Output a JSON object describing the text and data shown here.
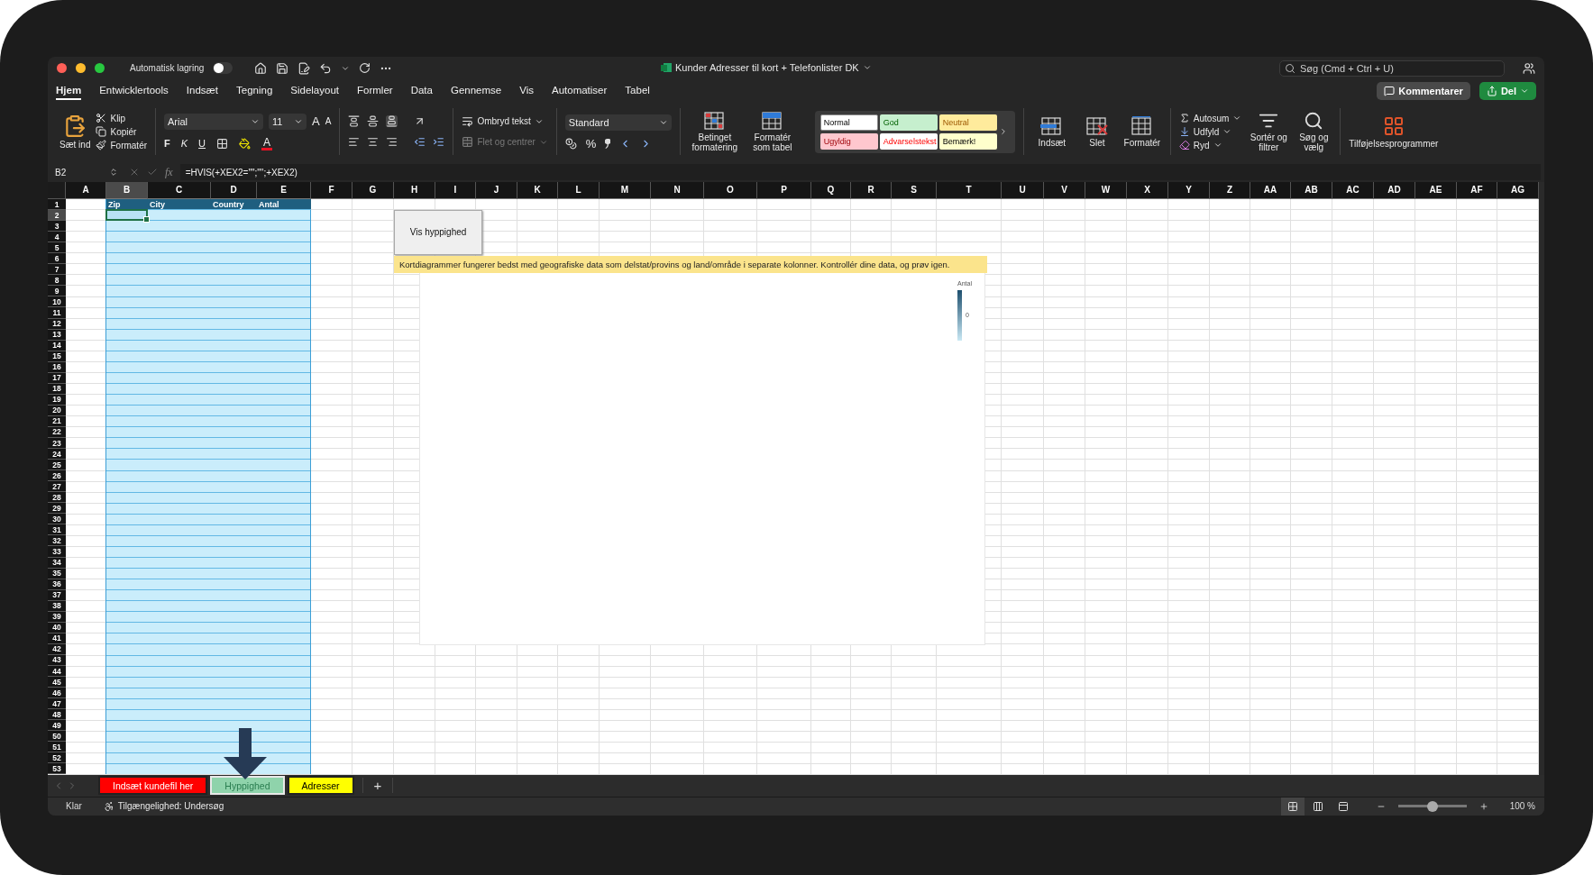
{
  "window": {
    "title": "Kunder Adresser til kort + Telefonlister DK",
    "autosave_label": "Automatisk lagring",
    "autosave_on": false
  },
  "search": {
    "placeholder": "Søg (Cmd + Ctrl + U)"
  },
  "ribbon_tabs": [
    {
      "label": "Hjem",
      "selected": true
    },
    {
      "label": "Entwicklertools",
      "selected": false
    },
    {
      "label": "Indsæt",
      "selected": false
    },
    {
      "label": "Tegning",
      "selected": false
    },
    {
      "label": "Sidelayout",
      "selected": false
    },
    {
      "label": "Formler",
      "selected": false
    },
    {
      "label": "Data",
      "selected": false
    },
    {
      "label": "Gennemse",
      "selected": false
    },
    {
      "label": "Vis",
      "selected": false
    },
    {
      "label": "Automatiser",
      "selected": false
    },
    {
      "label": "Tabel",
      "selected": false
    }
  ],
  "comments_button": "Kommentarer",
  "share_button": "Del",
  "clipboard": {
    "paste": "Sæt ind",
    "cut": "Klip",
    "copy": "Kopiér",
    "format_painter": "Formatér"
  },
  "font": {
    "name": "Arial",
    "size": "11",
    "grow": "A",
    "shrink": "A",
    "bold": "F",
    "italic": "K",
    "underline": "U",
    "font_color": "A"
  },
  "alignment": {
    "wrap_text": "Ombryd tekst",
    "merge_center": "Flet og centrer",
    "merge_disabled": true
  },
  "number": {
    "format": "Standard",
    "percent": "%"
  },
  "style_tools": [
    {
      "label": "Betinget formatering",
      "kind": "conditional"
    },
    {
      "label": "Formatér som tabel",
      "kind": "table"
    }
  ],
  "cell_styles": [
    {
      "label": "Normal",
      "kind": "normal",
      "selected": true
    },
    {
      "label": "God",
      "kind": "good",
      "selected": false
    },
    {
      "label": "Neutral",
      "kind": "neutral",
      "selected": false
    },
    {
      "label": "Ugyldig",
      "kind": "bad",
      "selected": false
    },
    {
      "label": "Advarselstekst",
      "kind": "warning",
      "selected": false
    },
    {
      "label": "Bemærk!",
      "kind": "note",
      "selected": false
    }
  ],
  "cells": [
    {
      "label": "Indsæt",
      "kind": "insert"
    },
    {
      "label": "Slet",
      "kind": "delete"
    },
    {
      "label": "Formatér",
      "kind": "format"
    }
  ],
  "editing": {
    "autosum": "Autosum",
    "fill": "Udfyld",
    "clear": "Ryd",
    "sort_filter": "Sortér og filtrer",
    "find_select": "Søg og vælg"
  },
  "addins": "Tilføjelsesprogrammer",
  "formula_bar": {
    "name_box": "B2",
    "fx": "fx",
    "formula": "=HVIS(+XEX2=\"\";\"\";+XEX2)"
  },
  "columns": [
    {
      "label": "A",
      "selected": false
    },
    {
      "label": "B",
      "selected": true
    },
    {
      "label": "C",
      "selected": false
    },
    {
      "label": "D",
      "selected": false
    },
    {
      "label": "E",
      "selected": false
    },
    {
      "label": "F",
      "selected": false
    },
    {
      "label": "G",
      "selected": false
    },
    {
      "label": "H",
      "selected": false
    },
    {
      "label": "I",
      "selected": false
    },
    {
      "label": "J",
      "selected": false
    },
    {
      "label": "K",
      "selected": false
    },
    {
      "label": "L",
      "selected": false
    },
    {
      "label": "M",
      "selected": false
    },
    {
      "label": "N",
      "selected": false
    },
    {
      "label": "O",
      "selected": false
    },
    {
      "label": "P",
      "selected": false
    },
    {
      "label": "Q",
      "selected": false
    },
    {
      "label": "R",
      "selected": false
    },
    {
      "label": "S",
      "selected": false
    },
    {
      "label": "T",
      "selected": false
    },
    {
      "label": "U",
      "selected": false
    },
    {
      "label": "V",
      "selected": false
    },
    {
      "label": "W",
      "selected": false
    },
    {
      "label": "X",
      "selected": false
    },
    {
      "label": "Y",
      "selected": false
    },
    {
      "label": "Z",
      "selected": false
    },
    {
      "label": "AA",
      "selected": false
    },
    {
      "label": "AB",
      "selected": false
    },
    {
      "label": "AC",
      "selected": false
    },
    {
      "label": "AD",
      "selected": false
    },
    {
      "label": "AE",
      "selected": false
    },
    {
      "label": "AF",
      "selected": false
    },
    {
      "label": "AG",
      "selected": false
    }
  ],
  "rows": [
    {
      "label": "1",
      "selected": false
    },
    {
      "label": "2",
      "selected": true
    },
    {
      "label": "3",
      "selected": false
    },
    {
      "label": "4",
      "selected": false
    },
    {
      "label": "5",
      "selected": false
    },
    {
      "label": "6",
      "selected": false
    },
    {
      "label": "7",
      "selected": false
    },
    {
      "label": "8",
      "selected": false
    },
    {
      "label": "9",
      "selected": false
    },
    {
      "label": "10",
      "selected": false
    },
    {
      "label": "11",
      "selected": false
    },
    {
      "label": "12",
      "selected": false
    },
    {
      "label": "13",
      "selected": false
    },
    {
      "label": "14",
      "selected": false
    },
    {
      "label": "15",
      "selected": false
    },
    {
      "label": "16",
      "selected": false
    },
    {
      "label": "17",
      "selected": false
    },
    {
      "label": "18",
      "selected": false
    },
    {
      "label": "19",
      "selected": false
    },
    {
      "label": "20",
      "selected": false
    },
    {
      "label": "21",
      "selected": false
    },
    {
      "label": "22",
      "selected": false
    },
    {
      "label": "23",
      "selected": false
    },
    {
      "label": "24",
      "selected": false
    },
    {
      "label": "25",
      "selected": false
    },
    {
      "label": "26",
      "selected": false
    },
    {
      "label": "27",
      "selected": false
    },
    {
      "label": "28",
      "selected": false
    },
    {
      "label": "29",
      "selected": false
    },
    {
      "label": "30",
      "selected": false
    },
    {
      "label": "31",
      "selected": false
    },
    {
      "label": "32",
      "selected": false
    },
    {
      "label": "33",
      "selected": false
    },
    {
      "label": "34",
      "selected": false
    },
    {
      "label": "35",
      "selected": false
    },
    {
      "label": "36",
      "selected": false
    },
    {
      "label": "37",
      "selected": false
    },
    {
      "label": "38",
      "selected": false
    },
    {
      "label": "39",
      "selected": false
    },
    {
      "label": "40",
      "selected": false
    },
    {
      "label": "41",
      "selected": false
    },
    {
      "label": "42",
      "selected": false
    },
    {
      "label": "43",
      "selected": false
    },
    {
      "label": "44",
      "selected": false
    },
    {
      "label": "45",
      "selected": false
    },
    {
      "label": "46",
      "selected": false
    },
    {
      "label": "47",
      "selected": false
    },
    {
      "label": "48",
      "selected": false
    },
    {
      "label": "49",
      "selected": false
    },
    {
      "label": "50",
      "selected": false
    },
    {
      "label": "51",
      "selected": false
    },
    {
      "label": "52",
      "selected": false
    },
    {
      "label": "53",
      "selected": false
    }
  ],
  "table": {
    "headers": [
      "Zip",
      "City",
      "Country",
      "Antal"
    ]
  },
  "button": "Vis hyppighed",
  "map_chart": {
    "message": "Kortdiagrammer fungerer bedst med geografiske data som delstat/provins og land/område i separate kolonner. Kontrollér dine data, og prøv igen.",
    "legend_title": "Antal",
    "legend_label": "0"
  },
  "sheet_tabs": [
    {
      "label": "Indsæt kundefil her",
      "color": "#ff0000",
      "selected": false
    },
    {
      "label": "Hyppighed",
      "color": "#8fd3ab",
      "selected": true
    },
    {
      "label": "Adresser",
      "color": "#ffff00",
      "selected": false
    }
  ],
  "add_sheet": "+",
  "status_bar": {
    "ready": "Klar",
    "accessibility": "Tilgængelighed: Undersøg",
    "zoom": "100 %"
  },
  "view_buttons": [
    {
      "kind": "normal",
      "selected": true
    },
    {
      "kind": "page_layout",
      "selected": false
    },
    {
      "kind": "page_break",
      "selected": false
    }
  ],
  "zoom_slider": {
    "level": 0.5
  }
}
